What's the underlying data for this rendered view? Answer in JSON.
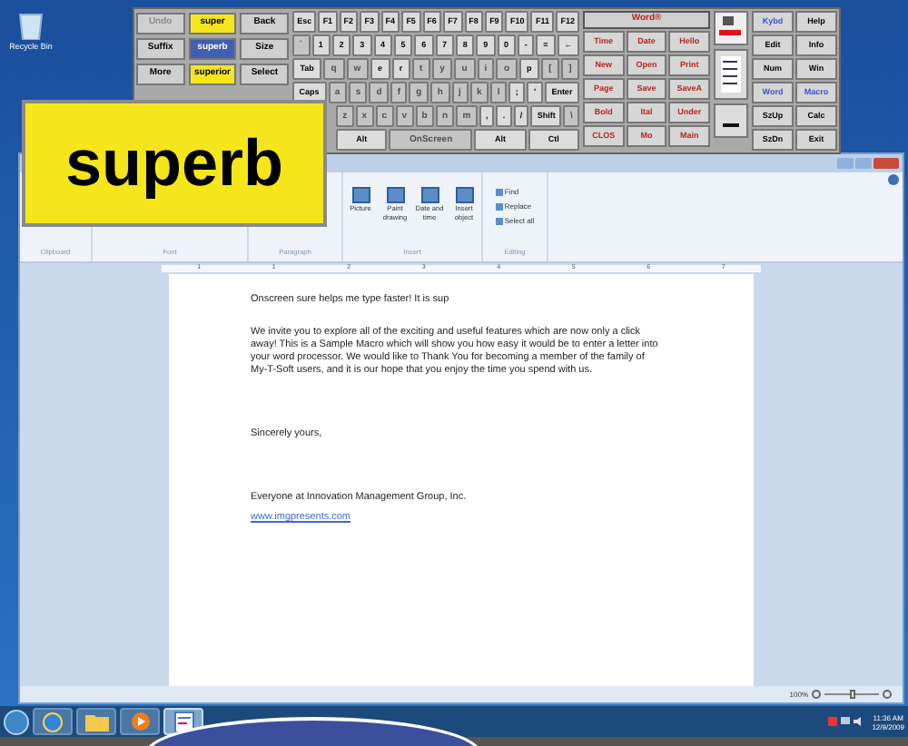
{
  "desktop_icons": [
    {
      "label": "Recycle Bin"
    }
  ],
  "keyboard": {
    "predictions": [
      [
        {
          "label": "Undo",
          "selected": false,
          "disabled": true
        },
        {
          "label": "super",
          "selected": false,
          "disabled": false
        },
        {
          "label": "Back",
          "selected": false,
          "disabled": false
        }
      ],
      [
        {
          "label": "Suffix",
          "selected": false,
          "disabled": false
        },
        {
          "label": "superb",
          "selected": true,
          "disabled": false
        },
        {
          "label": "Size",
          "selected": false,
          "disabled": false
        }
      ],
      [
        {
          "label": "More",
          "selected": false,
          "disabled": false
        },
        {
          "label": "superior",
          "selected": false,
          "disabled": false
        },
        {
          "label": "Select",
          "selected": false,
          "disabled": false
        }
      ]
    ],
    "key_rows": [
      [
        {
          "label": "Esc",
          "dim": false
        },
        {
          "label": "F1",
          "dim": false
        },
        {
          "label": "F2",
          "dim": false
        },
        {
          "label": "F3",
          "dim": false
        },
        {
          "label": "F4",
          "dim": false
        },
        {
          "label": "F5",
          "dim": false
        },
        {
          "label": "F6",
          "dim": false
        },
        {
          "label": "F7",
          "dim": false
        },
        {
          "label": "F8",
          "dim": false
        },
        {
          "label": "F9",
          "dim": false
        },
        {
          "label": "F10",
          "dim": false
        },
        {
          "label": "F11",
          "dim": false
        },
        {
          "label": "F12",
          "dim": false
        }
      ],
      [
        {
          "label": "`",
          "dim": true
        },
        {
          "label": "1",
          "dim": false
        },
        {
          "label": "2",
          "dim": false
        },
        {
          "label": "3",
          "dim": false
        },
        {
          "label": "4",
          "dim": false
        },
        {
          "label": "5",
          "dim": false
        },
        {
          "label": "6",
          "dim": false
        },
        {
          "label": "7",
          "dim": false
        },
        {
          "label": "8",
          "dim": false
        },
        {
          "label": "9",
          "dim": false
        },
        {
          "label": "0",
          "dim": false
        },
        {
          "label": "-",
          "dim": false
        },
        {
          "label": "=",
          "dim": false
        },
        {
          "label": "←",
          "dim": false
        }
      ],
      [
        {
          "label": "Tab",
          "dim": false
        },
        {
          "label": "q",
          "dim": true
        },
        {
          "label": "w",
          "dim": true
        },
        {
          "label": "e",
          "dim": false
        },
        {
          "label": "r",
          "dim": false
        },
        {
          "label": "t",
          "dim": true
        },
        {
          "label": "y",
          "dim": true
        },
        {
          "label": "u",
          "dim": true
        },
        {
          "label": "i",
          "dim": true
        },
        {
          "label": "o",
          "dim": true
        },
        {
          "label": "p",
          "dim": false
        },
        {
          "label": "[",
          "dim": true
        },
        {
          "label": "]",
          "dim": true
        }
      ],
      [
        {
          "label": "Caps",
          "dim": false
        },
        {
          "label": "a",
          "dim": true
        },
        {
          "label": "s",
          "dim": true
        },
        {
          "label": "d",
          "dim": true
        },
        {
          "label": "f",
          "dim": true
        },
        {
          "label": "g",
          "dim": true
        },
        {
          "label": "h",
          "dim": true
        },
        {
          "label": "j",
          "dim": true
        },
        {
          "label": "k",
          "dim": true
        },
        {
          "label": "l",
          "dim": true
        },
        {
          "label": ";",
          "dim": false
        },
        {
          "label": "'",
          "dim": false
        },
        {
          "label": "Enter",
          "dim": false
        }
      ],
      [
        {
          "label": "z",
          "dim": true
        },
        {
          "label": "x",
          "dim": true
        },
        {
          "label": "c",
          "dim": true
        },
        {
          "label": "v",
          "dim": true
        },
        {
          "label": "b",
          "dim": true
        },
        {
          "label": "n",
          "dim": true
        },
        {
          "label": "m",
          "dim": true
        },
        {
          "label": ",",
          "dim": false
        },
        {
          "label": ".",
          "dim": false
        },
        {
          "label": "/",
          "dim": false
        },
        {
          "label": "Shift",
          "dim": false
        },
        {
          "label": "\\",
          "dim": true
        }
      ],
      [
        {
          "label": "Alt",
          "dim": false
        },
        {
          "label": "OnScreen",
          "dim": true
        },
        {
          "label": "Alt",
          "dim": false
        },
        {
          "label": "Ctl",
          "dim": false
        }
      ]
    ],
    "macro_title": "Word®",
    "macros": [
      [
        "Time",
        "Date",
        "Hello"
      ],
      [
        "New",
        "Open",
        "Print"
      ],
      [
        "Page",
        "Save",
        "SaveA"
      ],
      [
        "Bold",
        "Ital",
        "Under"
      ],
      [
        "CLOS",
        "Mo",
        "Main"
      ]
    ],
    "side": [
      [
        {
          "label": "Kybd",
          "selected": true
        },
        {
          "label": "Help",
          "selected": false
        }
      ],
      [
        {
          "label": "Edit",
          "selected": false
        },
        {
          "label": "Info",
          "selected": false
        }
      ],
      [
        {
          "label": "Num",
          "selected": false
        },
        {
          "label": "Win",
          "selected": false
        }
      ],
      [
        {
          "label": "Word",
          "selected": true
        },
        {
          "label": "Macro",
          "selected": true
        }
      ],
      [
        {
          "label": "SzUp",
          "selected": false
        },
        {
          "label": "Calc",
          "selected": false
        }
      ],
      [
        {
          "label": "SzDn",
          "selected": false
        },
        {
          "label": "Exit",
          "selected": false
        }
      ]
    ]
  },
  "popup": {
    "text": "superb"
  },
  "wordpad": {
    "ribbon_groups": [
      "Clipboard",
      "Font",
      "Paragraph",
      "Insert",
      "Editing"
    ],
    "insert_buttons": [
      "Picture",
      "Paint drawing",
      "Date and time",
      "Insert object"
    ],
    "editing_buttons": [
      "Find",
      "Replace",
      "Select all"
    ],
    "ruler": [
      "1",
      "1",
      "2",
      "3",
      "4",
      "5",
      "6",
      "7"
    ],
    "paragraphs": [
      {
        "kind": "text",
        "text": "Onscreen sure helps me type faster!  It is sup"
      },
      {
        "kind": "text",
        "text": "We invite you to explore all of the exciting and useful features which are now only a click away! This is a Sample Macro which will show you how easy it would be to enter a letter into your word processor. We would like to Thank You for becoming a member of the family of My-T-Soft users, and it is our hope that you enjoy the time you spend with us."
      },
      {
        "kind": "text",
        "text": "Sincerely yours,"
      },
      {
        "kind": "text",
        "text": "Everyone at Innovation Management Group, Inc."
      },
      {
        "kind": "link",
        "text": "www.imgpresents.com"
      }
    ],
    "zoom": {
      "reading": "100%",
      "level": 0.5
    }
  },
  "taskbar": {
    "apps": [
      {
        "kind": "browser",
        "active": false
      },
      {
        "kind": "folder",
        "active": false
      },
      {
        "kind": "media",
        "active": false
      },
      {
        "kind": "document",
        "active": true
      }
    ],
    "time": "11:36 AM",
    "date": "12/9/2009"
  }
}
